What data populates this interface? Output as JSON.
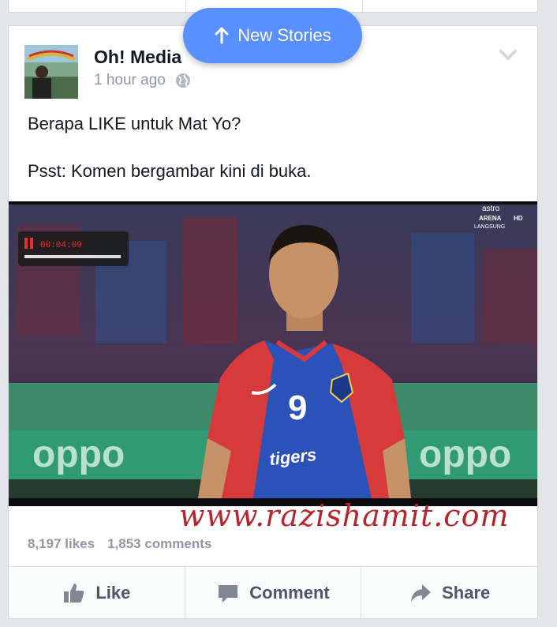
{
  "banner": {
    "label": "New Stories",
    "icon": "arrow-up-icon"
  },
  "post": {
    "author": "Oh! Media",
    "time": "1 hour ago",
    "privacy_icon": "globe-icon",
    "message_line1": "Berapa LIKE untuk Mat Yo?",
    "message_line2": "Psst: Komen bergambar kini di buka.",
    "photo": {
      "rec_time": "00:04:09",
      "channel": [
        "astro",
        "ARENA",
        "LANGSUNG"
      ],
      "hd_badge": "HD",
      "jersey_number": "9",
      "sponsor": "oppo",
      "watermark": "www.razishamit.com"
    },
    "likes": "8,197 likes",
    "comments": "1,853 comments"
  },
  "actions": [
    {
      "label": "Like",
      "icon": "thumbs-up-icon"
    },
    {
      "label": "Comment",
      "icon": "comment-bubble-icon"
    },
    {
      "label": "Share",
      "icon": "share-arrow-icon"
    }
  ],
  "colors": {
    "accent": "#5890ff",
    "text": "#141823",
    "muted": "#9197a3",
    "action": "#4e5665",
    "watermark": "#b8242b"
  }
}
